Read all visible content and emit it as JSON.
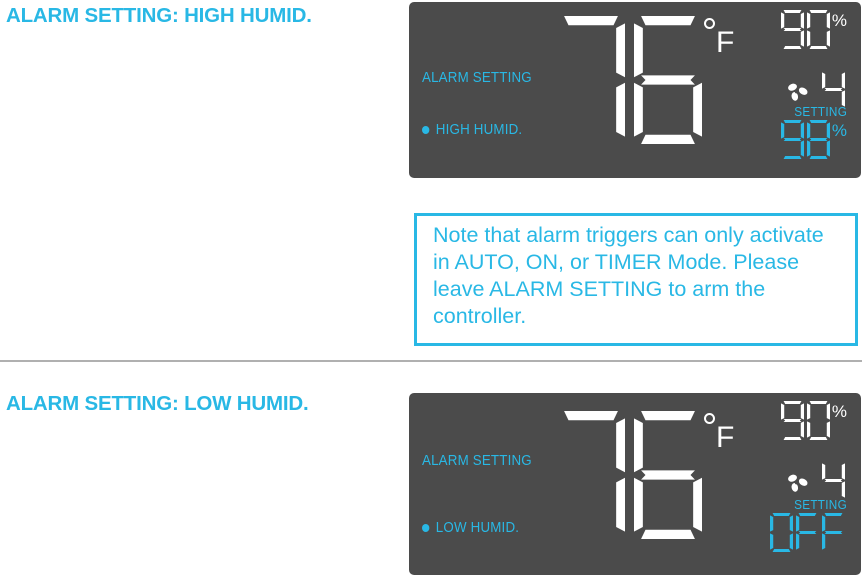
{
  "sections": [
    {
      "heading": "ALARM SETTING: HIGH HUMID.",
      "display": {
        "alarm_setting_label": "ALARM SETTING",
        "condition_label": "HIGH HUMID.",
        "temperature": "76",
        "unit": "°F",
        "unit_degree": "°",
        "unit_letter": "F",
        "humidity": "90",
        "humidity_percent": "%",
        "fan_icon": "fan-icon",
        "fan_speed": "4",
        "setting_caption": "SETTING",
        "setting_value": "98",
        "setting_percent": "%"
      }
    },
    {
      "heading": "ALARM SETTING: LOW HUMID.",
      "display": {
        "alarm_setting_label": "ALARM SETTING",
        "condition_label": "LOW HUMID.",
        "temperature": "76",
        "unit": "°F",
        "unit_degree": "°",
        "unit_letter": "F",
        "humidity": "90",
        "humidity_percent": "%",
        "fan_icon": "fan-icon",
        "fan_speed": "4",
        "setting_caption": "SETTING",
        "setting_value": "OFF",
        "setting_percent": ""
      }
    }
  ],
  "note": {
    "text": "Note that alarm triggers can only activate in AUTO, ON, or TIMER Mode. Please leave ALARM SETTING to arm the controller."
  },
  "colors": {
    "accent_cyan": "#29b8e5",
    "lcd_background": "#4b4b4b",
    "lcd_white": "#ffffff",
    "divider_gray": "#b0b0b0"
  }
}
